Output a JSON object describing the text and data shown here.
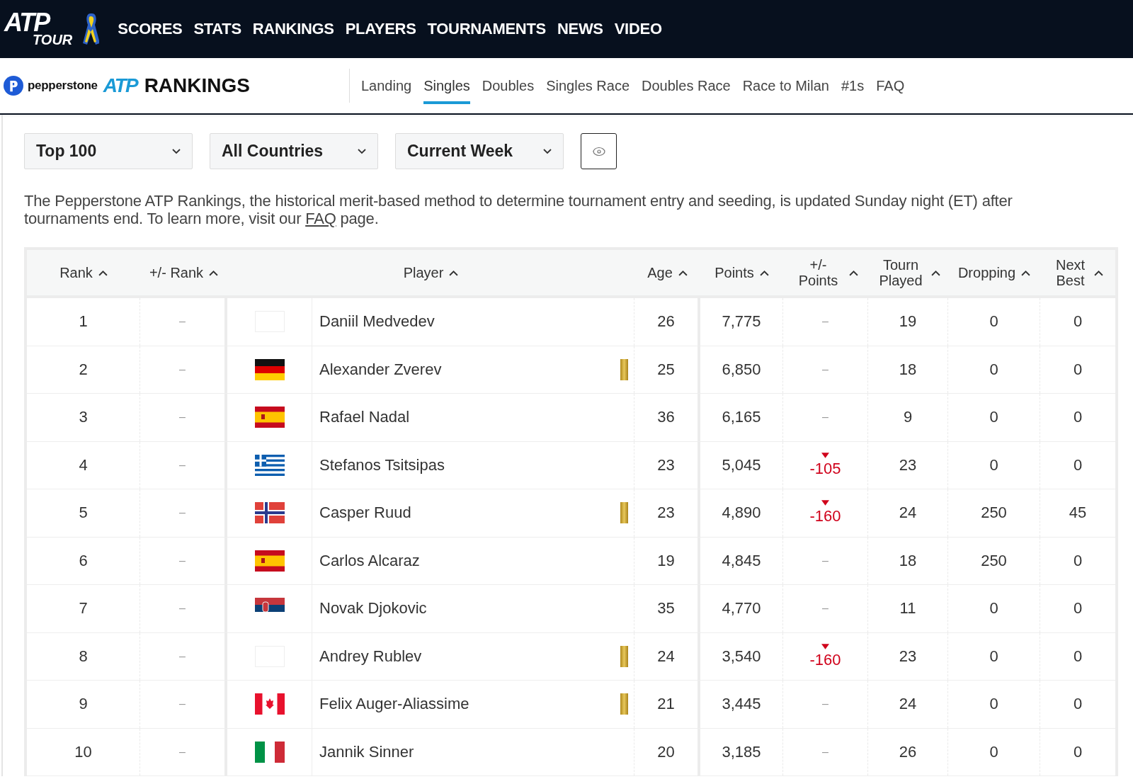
{
  "top_nav": {
    "logo": {
      "main": "ATP",
      "sub": "TOUR"
    },
    "items": [
      "SCORES",
      "STATS",
      "RANKINGS",
      "PLAYERS",
      "TOURNAMENTS",
      "NEWS",
      "VIDEO"
    ]
  },
  "sub_nav": {
    "sponsor": "pepperstone",
    "brand": "ATP",
    "title": "RANKINGS",
    "tabs": [
      {
        "label": "Landing",
        "selected": false
      },
      {
        "label": "Singles",
        "selected": true
      },
      {
        "label": "Doubles",
        "selected": false
      },
      {
        "label": "Singles Race",
        "selected": false
      },
      {
        "label": "Doubles Race",
        "selected": false
      },
      {
        "label": "Race to Milan",
        "selected": false
      },
      {
        "label": "#1s",
        "selected": false
      },
      {
        "label": "FAQ",
        "selected": false
      }
    ]
  },
  "filters": [
    "Top 100",
    "All Countries",
    "Current Week"
  ],
  "description": {
    "text": "The Pepperstone ATP Rankings, the historical merit-based method to determine tournament entry and seeding, is updated Sunday night (ET) after tournaments end. To learn more, visit our ",
    "link": "FAQ",
    "after": " page."
  },
  "table": {
    "columns": {
      "rank": "Rank",
      "rank_change": "+/- Rank",
      "player": "Player",
      "age": "Age",
      "points": "Points",
      "points_change": "+/- Points",
      "tourn_played": "Tourn Played",
      "dropping": "Dropping",
      "next_best": "Next Best"
    },
    "rows": [
      {
        "rank": "1",
        "rank_change": "–",
        "flag": {
          "kind": "none"
        },
        "player": "Daniil Medvedev",
        "marker": false,
        "age": "26",
        "points": "7,775",
        "points_change": {
          "kind": "none",
          "text": "–"
        },
        "tourn_played": "19",
        "dropping": "0",
        "next_best": "0"
      },
      {
        "rank": "2",
        "rank_change": "–",
        "flag": {
          "kind": "de"
        },
        "player": "Alexander Zverev",
        "marker": true,
        "age": "25",
        "points": "6,850",
        "points_change": {
          "kind": "none",
          "text": "–"
        },
        "tourn_played": "18",
        "dropping": "0",
        "next_best": "0"
      },
      {
        "rank": "3",
        "rank_change": "–",
        "flag": {
          "kind": "es"
        },
        "player": "Rafael Nadal",
        "marker": false,
        "age": "36",
        "points": "6,165",
        "points_change": {
          "kind": "none",
          "text": "–"
        },
        "tourn_played": "9",
        "dropping": "0",
        "next_best": "0"
      },
      {
        "rank": "4",
        "rank_change": "–",
        "flag": {
          "kind": "gr"
        },
        "player": "Stefanos Tsitsipas",
        "marker": false,
        "age": "23",
        "points": "5,045",
        "points_change": {
          "kind": "down",
          "text": "-105"
        },
        "tourn_played": "23",
        "dropping": "0",
        "next_best": "0"
      },
      {
        "rank": "5",
        "rank_change": "–",
        "flag": {
          "kind": "no"
        },
        "player": "Casper Ruud",
        "marker": true,
        "age": "23",
        "points": "4,890",
        "points_change": {
          "kind": "down",
          "text": "-160"
        },
        "tourn_played": "24",
        "dropping": "250",
        "next_best": "45"
      },
      {
        "rank": "6",
        "rank_change": "–",
        "flag": {
          "kind": "es"
        },
        "player": "Carlos Alcaraz",
        "marker": false,
        "age": "19",
        "points": "4,845",
        "points_change": {
          "kind": "none",
          "text": "–"
        },
        "tourn_played": "18",
        "dropping": "250",
        "next_best": "0"
      },
      {
        "rank": "7",
        "rank_change": "–",
        "flag": {
          "kind": "rs"
        },
        "player": "Novak Djokovic",
        "marker": false,
        "age": "35",
        "points": "4,770",
        "points_change": {
          "kind": "none",
          "text": "–"
        },
        "tourn_played": "11",
        "dropping": "0",
        "next_best": "0"
      },
      {
        "rank": "8",
        "rank_change": "–",
        "flag": {
          "kind": "none"
        },
        "player": "Andrey Rublev",
        "marker": true,
        "age": "24",
        "points": "3,540",
        "points_change": {
          "kind": "down",
          "text": "-160"
        },
        "tourn_played": "23",
        "dropping": "0",
        "next_best": "0"
      },
      {
        "rank": "9",
        "rank_change": "–",
        "flag": {
          "kind": "ca"
        },
        "player": "Felix Auger-Aliassime",
        "marker": true,
        "age": "21",
        "points": "3,445",
        "points_change": {
          "kind": "none",
          "text": "–"
        },
        "tourn_played": "24",
        "dropping": "0",
        "next_best": "0"
      },
      {
        "rank": "10",
        "rank_change": "–",
        "flag": {
          "kind": "it"
        },
        "player": "Jannik Sinner",
        "marker": false,
        "age": "20",
        "points": "3,185",
        "points_change": {
          "kind": "none",
          "text": "–"
        },
        "tourn_played": "26",
        "dropping": "0",
        "next_best": "0"
      }
    ]
  }
}
